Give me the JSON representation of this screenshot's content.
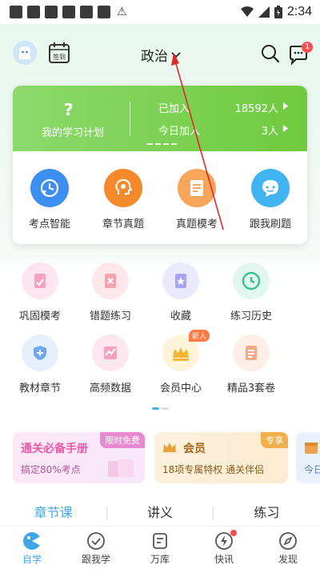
{
  "status_bar": {
    "time": "2:34"
  },
  "header": {
    "subject": "政治",
    "message_count": "1"
  },
  "study_card": {
    "plan_mark": "?",
    "plan_label": "我的学习计划",
    "joined_label": "已加入",
    "joined_value": "18592人",
    "today_label": "今日加入",
    "today_value": "3人",
    "items": [
      {
        "label": "考点智能",
        "icon": "clock-lightning-icon",
        "color": "#3c8ff0"
      },
      {
        "label": "章节真题",
        "icon": "brain-gear-icon",
        "color": "#f58a2c"
      },
      {
        "label": "真题模考",
        "icon": "exam-paper-icon",
        "color": "#f6a55a"
      },
      {
        "label": "跟我刷题",
        "icon": "chat-bubble-icon",
        "color": "#3fb4f0"
      }
    ]
  },
  "grid": {
    "row1": [
      {
        "label": "巩固模考",
        "icon": "consolidate-icon",
        "bg": "#fde6ef",
        "fg": "#f27aa4"
      },
      {
        "label": "错题练习",
        "icon": "wrong-question-icon",
        "bg": "#fde7ea",
        "fg": "#f0808e"
      },
      {
        "label": "收藏",
        "icon": "favorite-star-icon",
        "bg": "#ebeafd",
        "fg": "#8d86ef"
      },
      {
        "label": "练习历史",
        "icon": "history-clock-icon",
        "bg": "#e2f7ef",
        "fg": "#38c28f"
      }
    ],
    "row2": [
      {
        "label": "教材章节",
        "icon": "textbook-shield-icon",
        "bg": "#e6f0fd",
        "fg": "#4b8ff0"
      },
      {
        "label": "高频数据",
        "icon": "high-frequency-chart-icon",
        "bg": "#fde7ef",
        "fg": "#f27aa4"
      },
      {
        "label": "会员中心",
        "icon": "crown-icon",
        "bg": "#fff4d9",
        "fg": "#f5b731",
        "badge": "新人"
      },
      {
        "label": "精品3套卷",
        "icon": "premium-paper-icon",
        "bg": "#fdeee6",
        "fg": "#f08a5d"
      }
    ]
  },
  "promos": [
    {
      "title": "通关必备手册",
      "sub": "搞定80%考点",
      "tag": "限时免费",
      "title_color": "#e85aa8",
      "tag_color": "#e98ad0"
    },
    {
      "title": "会员",
      "sub": "18项专属特权  通关伴侣",
      "tag": "专享",
      "title_color": "#a5661b",
      "tag_color": "#f1b04c"
    },
    {
      "title": "",
      "sub": "今日"
    }
  ],
  "section_tabs": [
    "章节课",
    "讲义",
    "练习"
  ],
  "bottom_nav": [
    "自学",
    "跟我学",
    "万库",
    "快讯",
    "发现"
  ]
}
